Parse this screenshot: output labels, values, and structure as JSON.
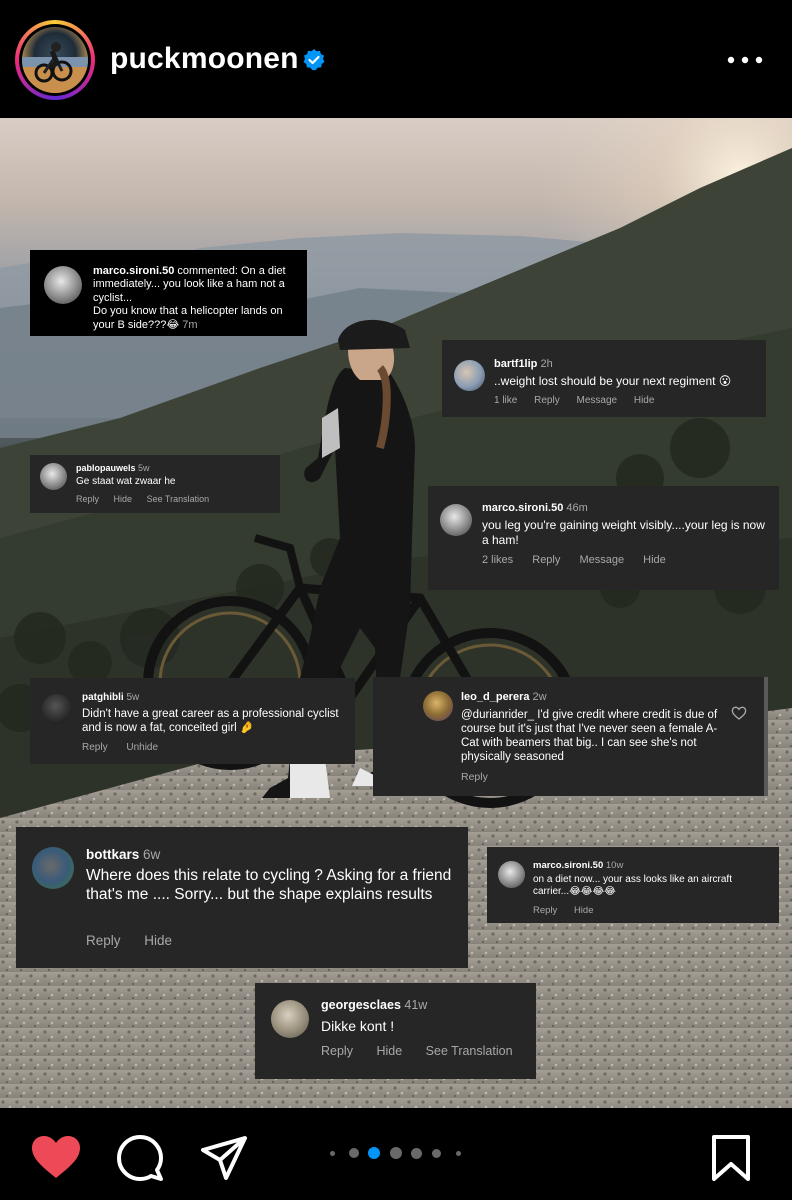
{
  "header": {
    "username": "puckmoonen"
  },
  "comments": [
    {
      "user": "marco.sironi.50",
      "text": "commented: On a diet immediately... you look like a ham not a cyclist...",
      "text2": "Do you know that a helicopter lands on your B side???😂",
      "time": "7m"
    },
    {
      "user": "bartf1lip",
      "time": "2h",
      "text": "..weight lost should be your next regiment 😮",
      "actions": [
        "1 like",
        "Reply",
        "Message",
        "Hide"
      ]
    },
    {
      "user": "pablopauwels",
      "time": "5w",
      "text": "Ge staat wat zwaar he",
      "actions": [
        "Reply",
        "Hide",
        "See Translation"
      ]
    },
    {
      "user": "marco.sironi.50",
      "time": "46m",
      "text": "you leg you're gaining weight visibly....your leg is now a ham!",
      "actions": [
        "2 likes",
        "Reply",
        "Message",
        "Hide"
      ]
    },
    {
      "user": "patghibli",
      "time": "5w",
      "text": "Didn't have a great career as a professional cyclist and is now a fat, conceited girl 🤌",
      "actions": [
        "Reply",
        "Unhide"
      ]
    },
    {
      "user": "leo_d_perera",
      "time": "2w",
      "text": "@durianrider_ I'd give credit where  credit is due of course but it's just that I've never seen a female A-Cat with beamers that big.. I can see she's not physically seasoned",
      "actions": [
        "Reply"
      ]
    },
    {
      "user": "bottkars",
      "time": "6w",
      "text": "Where does this relate to cycling ? Asking for a friend that's me .... Sorry... but the shape explains results",
      "actions": [
        "Reply",
        "Hide"
      ]
    },
    {
      "user": "marco.sironi.50",
      "time": "10w",
      "text": "on a diet now... your ass looks like an aircraft carrier...😂😂😂😂",
      "actions": [
        "Reply",
        "Hide"
      ]
    },
    {
      "user": "georgesclaes",
      "time": "41w",
      "text": "Dikke kont !",
      "actions": [
        "Reply",
        "Hide",
        "See Translation"
      ]
    }
  ],
  "carousel": {
    "total": 6,
    "active_index": 1
  },
  "colors": {
    "like": "#ed4956",
    "verified": "#0095f6",
    "carousel_active": "#0095f6",
    "comment_bg": "#262626"
  },
  "icons": [
    "verified-badge-icon",
    "more-options-icon",
    "heart-icon",
    "comment-icon",
    "share-icon",
    "bookmark-icon",
    "like-comment-icon"
  ]
}
